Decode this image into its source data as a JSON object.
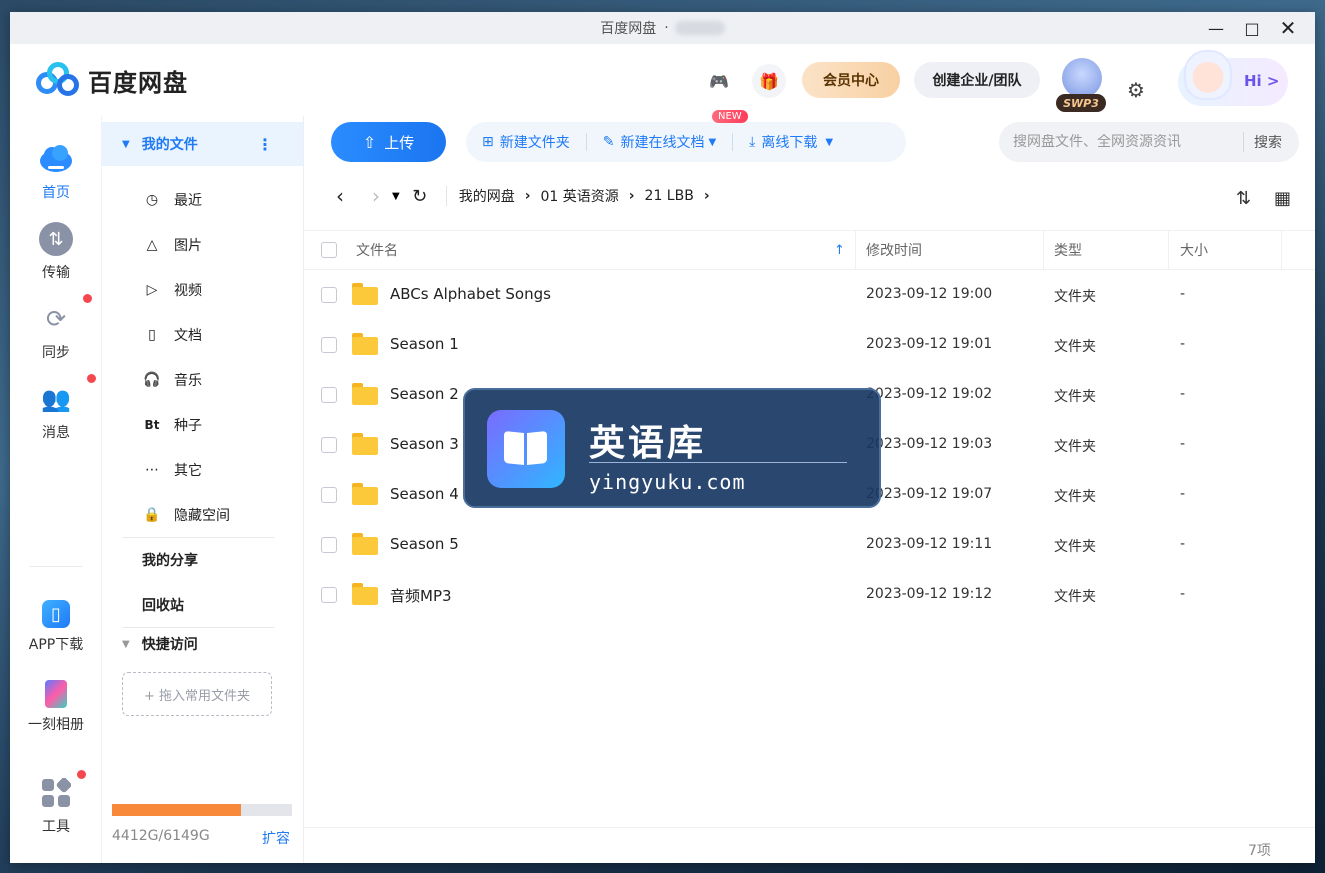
{
  "window": {
    "title": "百度网盘",
    "title_sep": "·"
  },
  "header": {
    "logo_text": "百度网盘",
    "vip_center": "会员中心",
    "create_enterprise": "创建企业/团队",
    "svip_badge": "SWP3",
    "hi_text": "Hi >",
    "icons": [
      "game-icon",
      "gift-icon",
      "avatar",
      "gear-icon"
    ]
  },
  "rail": {
    "items": [
      {
        "label": "首页",
        "icon": "cloud-home-icon",
        "active": true
      },
      {
        "label": "传输",
        "icon": "transfer-icon"
      },
      {
        "label": "同步",
        "icon": "sync-icon",
        "dot": true
      },
      {
        "label": "消息",
        "icon": "message-icon",
        "dot": true
      },
      {
        "label": "APP下载",
        "icon": "phone-app-icon"
      },
      {
        "label": "一刻相册",
        "icon": "album-icon"
      },
      {
        "label": "工具",
        "icon": "tools-icon",
        "dot": true
      }
    ]
  },
  "sidenav": {
    "my_files": "我的文件",
    "items": [
      {
        "label": "最近",
        "icon": "clock-icon"
      },
      {
        "label": "图片",
        "icon": "image-icon"
      },
      {
        "label": "视频",
        "icon": "play-icon"
      },
      {
        "label": "文档",
        "icon": "document-icon"
      },
      {
        "label": "音乐",
        "icon": "headphones-icon"
      },
      {
        "label": "种子",
        "icon": "torrent-icon",
        "glyph": "Bt"
      },
      {
        "label": "其它",
        "icon": "more-icon"
      },
      {
        "label": "隐藏空间",
        "icon": "lock-icon"
      }
    ],
    "my_share": "我的分享",
    "recycle": "回收站",
    "quick_access": "快捷访问",
    "drop_hint": "+ 拖入常用文件夹",
    "quota_text": "4412G/6149G",
    "quota_used_fraction": 0.7175,
    "expand": "扩容"
  },
  "toolbar": {
    "upload": "上传",
    "new_folder": "新建文件夹",
    "new_online_doc": "新建在线文档",
    "new_badge": "NEW",
    "offline_download": "离线下载",
    "search_placeholder": "搜网盘文件、全网资源资讯",
    "search_button": "搜索"
  },
  "breadcrumb": [
    "我的网盘",
    "01 英语资源",
    "21 LBB"
  ],
  "table": {
    "headers": {
      "name": "文件名",
      "time": "修改时间",
      "type": "类型",
      "size": "大小"
    },
    "rows": [
      {
        "name": "ABCs Alphabet Songs",
        "time": "2023-09-12 19:00",
        "type": "文件夹",
        "size": "-"
      },
      {
        "name": "Season 1",
        "time": "2023-09-12 19:01",
        "type": "文件夹",
        "size": "-"
      },
      {
        "name": "Season 2",
        "time": "2023-09-12 19:02",
        "type": "文件夹",
        "size": "-"
      },
      {
        "name": "Season 3",
        "time": "2023-09-12 19:03",
        "type": "文件夹",
        "size": "-"
      },
      {
        "name": "Season 4",
        "time": "2023-09-12 19:07",
        "type": "文件夹",
        "size": "-"
      },
      {
        "name": "Season 5",
        "time": "2023-09-12 19:11",
        "type": "文件夹",
        "size": "-"
      },
      {
        "name": "音频MP3",
        "time": "2023-09-12 19:12",
        "type": "文件夹",
        "size": "-"
      }
    ],
    "count": "7项"
  },
  "watermark": {
    "title": "英语库",
    "url": "yingyuku.com"
  },
  "colors": {
    "accent": "#1e7af5",
    "quota_fill": "#f9893a",
    "red_dot": "#f5484e",
    "folder": "#fcc93a"
  }
}
